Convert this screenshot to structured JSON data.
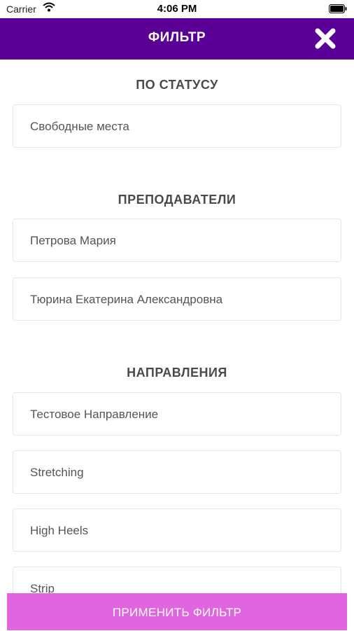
{
  "status_bar": {
    "carrier": "Carrier",
    "time": "4:06 PM"
  },
  "header": {
    "title": "ФИЛЬТР",
    "close_icon": "close-icon",
    "background": "#5a0096"
  },
  "sections": [
    {
      "title": "ПО СТАТУСУ",
      "items": [
        "Свободные места"
      ]
    },
    {
      "title": "ПРЕПОДАВАТЕЛИ",
      "items": [
        "Петрова Мария",
        "Тюрина Екатерина Александровна"
      ]
    },
    {
      "title": "НАПРАВЛЕНИЯ",
      "items": [
        "Тестовое Направление",
        "Stretching",
        "High Heels",
        "Strip"
      ]
    }
  ],
  "apply_button": {
    "label": "ПРИМЕНИТЬ ФИЛЬТР",
    "color": "#e066e0"
  }
}
